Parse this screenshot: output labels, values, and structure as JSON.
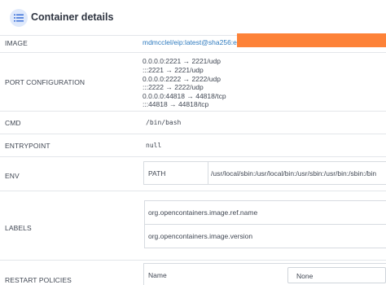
{
  "header": {
    "title": "Container details",
    "icon": "list-icon"
  },
  "image": {
    "label": "IMAGE",
    "value": "mdmcclel/eip:latest@sha256:e4f"
  },
  "ports": {
    "label": "PORT CONFIGURATION",
    "lines": [
      "0.0.0.0:2221 → 2221/udp",
      ":::2221 → 2221/udp",
      "0.0.0.0:2222 → 2222/udp",
      ":::2222 → 2222/udp",
      "0.0.0.0:44818 → 44818/tcp",
      ":::44818 → 44818/tcp"
    ]
  },
  "cmd": {
    "label": "CMD",
    "value": "/bin/bash"
  },
  "entrypoint": {
    "label": "ENTRYPOINT",
    "value": "null"
  },
  "env": {
    "label": "ENV",
    "key": "PATH",
    "value": "/usr/local/sbin:/usr/local/bin:/usr/sbin:/usr/bin:/sbin:/bin"
  },
  "labels": {
    "label": "LABELS",
    "items": [
      "org.opencontainers.image.ref.name",
      "org.opencontainers.image.version"
    ]
  },
  "restart": {
    "label": "RESTART POLICIES",
    "name_label": "Name",
    "select_value": "None"
  },
  "colors": {
    "link": "#2f7bbf",
    "redaction": "#fd8238",
    "icon_bg": "#dfe9fb"
  }
}
